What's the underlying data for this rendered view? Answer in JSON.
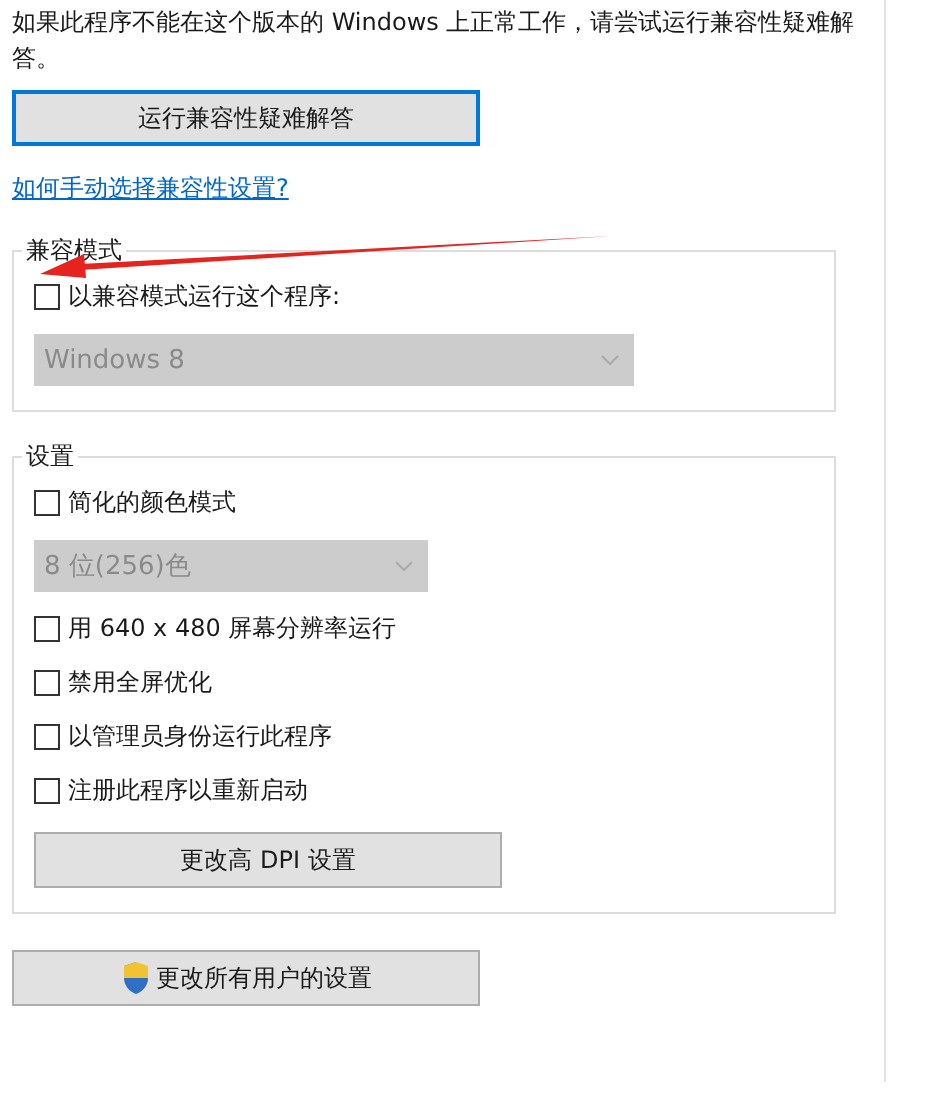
{
  "intro": "如果此程序不能在这个版本的 Windows 上正常工作，请尝试运行兼容性疑难解答。",
  "troubleshoot_button": "运行兼容性疑难解答",
  "help_link": "如何手动选择兼容性设置?",
  "groups": [
    {
      "title": "兼容模式",
      "items": [
        {
          "kind": "checkbox",
          "label": "以兼容模式运行这个程序:",
          "checked": false
        },
        {
          "kind": "dropdown",
          "value": "Windows 8",
          "disabled": true,
          "wide": true
        }
      ]
    },
    {
      "title": "设置",
      "items": [
        {
          "kind": "checkbox",
          "label": "简化的颜色模式",
          "checked": false
        },
        {
          "kind": "dropdown",
          "value": "8 位(256)色",
          "disabled": true,
          "wide": false
        },
        {
          "kind": "checkbox",
          "label": "用 640 x 480 屏幕分辨率运行",
          "checked": false
        },
        {
          "kind": "checkbox",
          "label": "禁用全屏优化",
          "checked": false
        },
        {
          "kind": "checkbox",
          "label": "以管理员身份运行此程序",
          "checked": false
        },
        {
          "kind": "checkbox",
          "label": "注册此程序以重新启动",
          "checked": false
        },
        {
          "kind": "button",
          "label": "更改高 DPI 设置"
        }
      ]
    }
  ],
  "all_users_button": "更改所有用户的设置"
}
